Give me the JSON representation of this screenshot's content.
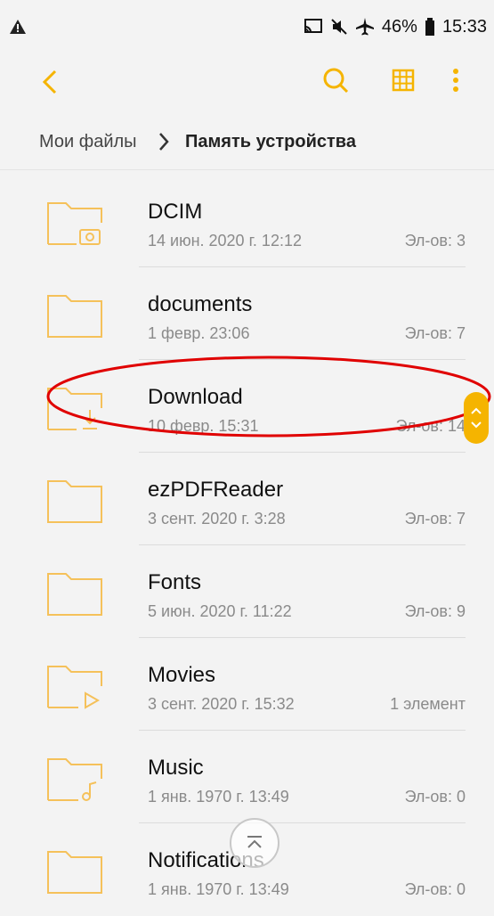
{
  "status": {
    "battery_percent": "46%",
    "time": "15:33"
  },
  "breadcrumb": {
    "root": "Мои файлы",
    "current": "Память устройства"
  },
  "folders": [
    {
      "name": "DCIM",
      "date": "14 июн. 2020 г. 12:12",
      "count": "Эл-ов: 3",
      "icon": "camera-folder-icon"
    },
    {
      "name": "documents",
      "date": "1 февр. 23:06",
      "count": "Эл-ов: 7",
      "icon": "folder-icon"
    },
    {
      "name": "Download",
      "date": "10 февр. 15:31",
      "count": "Эл-ов: 14",
      "icon": "download-folder-icon"
    },
    {
      "name": "ezPDFReader",
      "date": "3 сент. 2020 г. 3:28",
      "count": "Эл-ов: 7",
      "icon": "folder-icon"
    },
    {
      "name": "Fonts",
      "date": "5 июн. 2020 г. 11:22",
      "count": "Эл-ов: 9",
      "icon": "folder-icon"
    },
    {
      "name": "Movies",
      "date": "3 сент. 2020 г. 15:32",
      "count": "1 элемент",
      "icon": "video-folder-icon"
    },
    {
      "name": "Music",
      "date": "1 янв. 1970 г. 13:49",
      "count": "Эл-ов: 0",
      "icon": "music-folder-icon"
    },
    {
      "name": "Notifications",
      "date": "1 янв. 1970 г. 13:49",
      "count": "Эл-ов: 0",
      "icon": "folder-icon"
    }
  ],
  "colors": {
    "accent": "#f5b400",
    "highlight": "#e00000",
    "background": "#f3f3f3"
  }
}
